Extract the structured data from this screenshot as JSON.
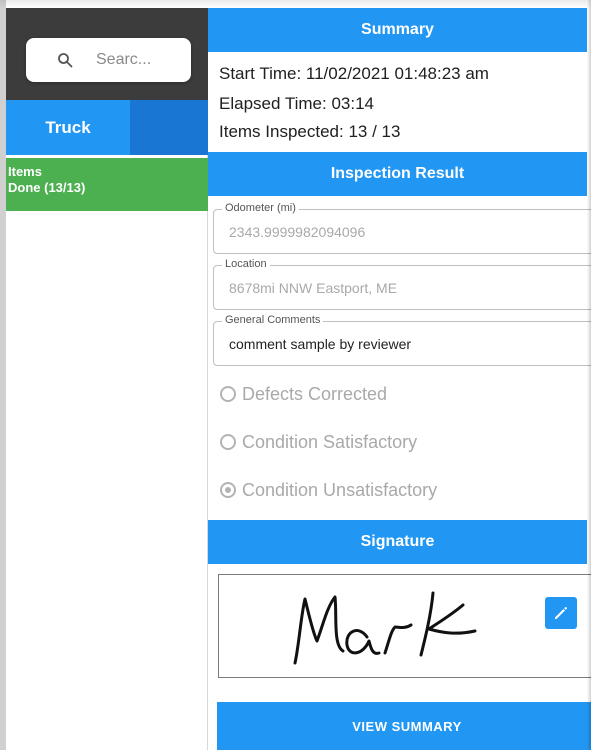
{
  "search": {
    "placeholder": "Searc..."
  },
  "tabs": {
    "truck": "Truck"
  },
  "sidebar": {
    "items_title": "Items",
    "items_status": "Done (13/13)"
  },
  "summary": {
    "header": "Summary",
    "start_time": "Start Time: 11/02/2021 01:48:23 am",
    "elapsed_time": "Elapsed Time: 03:14",
    "items_inspected": "Items Inspected: 13 / 13"
  },
  "inspection": {
    "header": "Inspection Result",
    "odometer": {
      "label": "Odometer (mi)",
      "value": "2343.9999982094096"
    },
    "location": {
      "label": "Location",
      "value": "8678mi NNW Eastport, ME"
    },
    "comments": {
      "label": "General Comments",
      "value": "comment sample by reviewer"
    },
    "options": [
      {
        "label": "Defects Corrected",
        "checked": false
      },
      {
        "label": "Condition Satisfactory",
        "checked": false
      },
      {
        "label": "Condition Unsatisfactory",
        "checked": true
      }
    ]
  },
  "signature": {
    "header": "Signature",
    "name": "Mark"
  },
  "actions": {
    "view_summary": "VIEW SUMMARY"
  },
  "colors": {
    "primary": "#2196f3",
    "tab_dark": "#1976d2",
    "items_green": "#4caf50",
    "search_bg": "#3c3c3c"
  }
}
